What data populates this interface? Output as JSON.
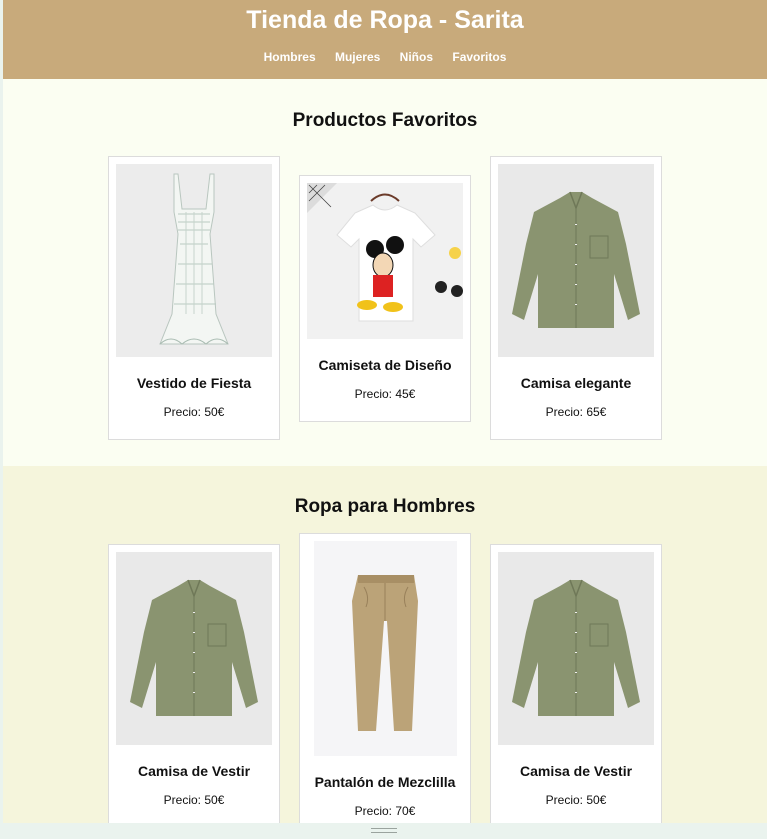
{
  "header": {
    "title": "Tienda de Ropa - Sarita",
    "nav": [
      "Hombres",
      "Mujeres",
      "Niños",
      "Favoritos"
    ]
  },
  "favoritos": {
    "heading": "Productos Favoritos",
    "products": [
      {
        "name": "Vestido de Fiesta",
        "price": "Precio: 50€",
        "image": "dress-image"
      },
      {
        "name": "Camiseta de Diseño",
        "price": "Precio: 45€",
        "image": "tshirt-image"
      },
      {
        "name": "Camisa elegante",
        "price": "Precio: 65€",
        "image": "shirt-image"
      }
    ]
  },
  "hombres": {
    "heading": "Ropa para Hombres",
    "products": [
      {
        "name": "Camisa de Vestir",
        "price": "Precio: 50€",
        "image": "shirt-image"
      },
      {
        "name": "Pantalón de Mezclilla",
        "price": "Precio: 70€",
        "image": "pants-image"
      },
      {
        "name": "Camisa de Vestir",
        "price": "Precio: 50€",
        "image": "shirt-image"
      }
    ]
  },
  "colors": {
    "header": "#c8aa7b",
    "favoritos_bg": "#fbfef2",
    "hombres_bg": "#f5f5dc"
  }
}
